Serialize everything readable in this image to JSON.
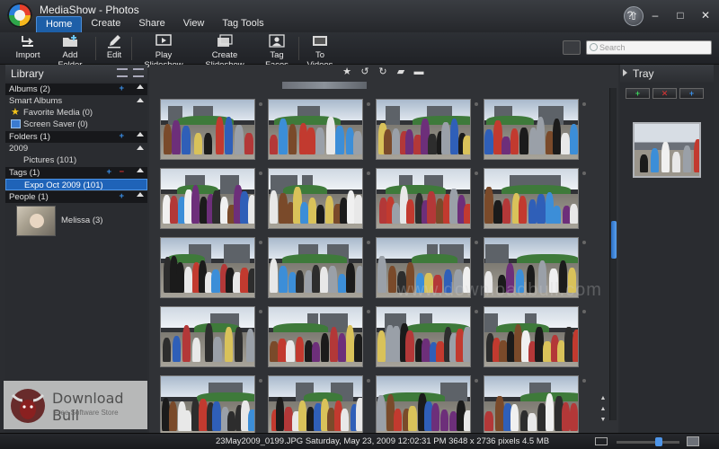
{
  "app": {
    "title": "MediaShow - Photos",
    "menu": [
      "Home",
      "Create",
      "Share",
      "View",
      "Tag Tools"
    ],
    "active_menu": "Home",
    "window_controls": [
      "?",
      "–",
      "□",
      "✕"
    ]
  },
  "toolbar": {
    "import": "Import",
    "add_folder": "Add Folder",
    "edit": "Edit",
    "play_slideshow": "Play Slideshow",
    "create_slideshow": "Create Slideshow",
    "tag_faces": "Tag Faces",
    "to_videos": "To Videos",
    "search_placeholder": "Search"
  },
  "library": {
    "title": "Library",
    "albums": "Albums (2)",
    "smart_albums": "Smart Albums",
    "favorite_media": "Favorite Media (0)",
    "screen_saver": "Screen Saver (0)",
    "folders": "Folders (1)",
    "year": "2009",
    "pictures": "Pictures (101)",
    "tags": "Tags (1)",
    "tag_selected": "Expo Oct 2009 (101)",
    "people": "People (1)",
    "person_name": "Melissa (3)"
  },
  "tray": {
    "title": "Tray",
    "btn_add_green": "+",
    "btn_remove": "✕",
    "btn_add_blue": "+"
  },
  "status": {
    "text": "23May2009_0199.JPG  Saturday, May 23, 2009 12:02:31 PM  3648 x 2736 pixels  4.5 MB",
    "zoom_level": 0.7
  },
  "watermark": {
    "center": "www.downloadbull.com",
    "brand": "Download Bull",
    "tagline": "Free Software Store"
  },
  "colors": {
    "accent": "#1f63b8",
    "background": "#303236",
    "panel": "#2a2c30"
  }
}
